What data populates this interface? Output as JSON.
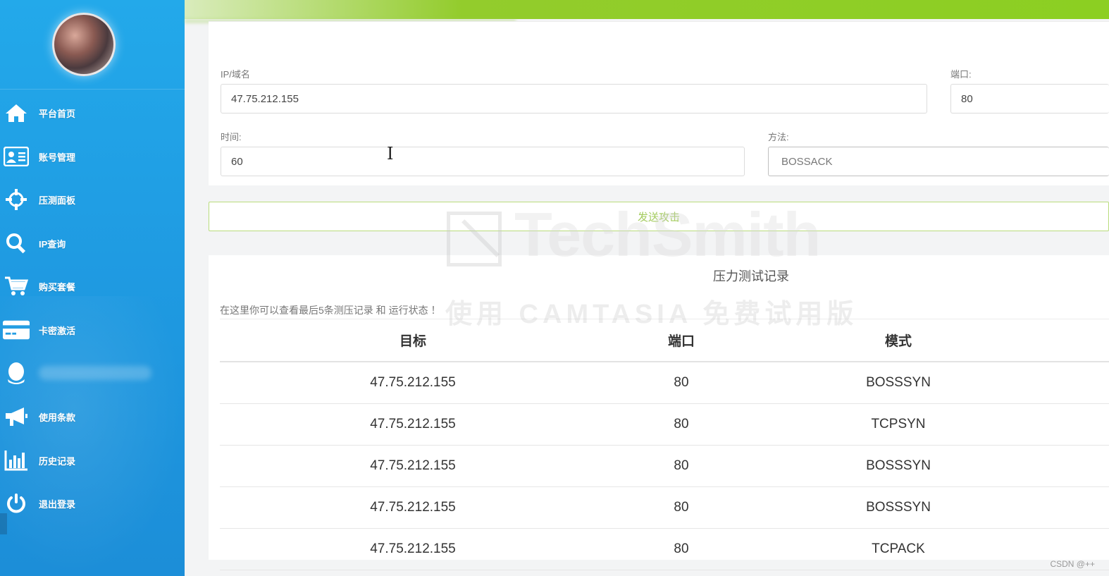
{
  "sidebar": {
    "items": [
      {
        "label": "平台首页",
        "icon": "home-icon"
      },
      {
        "label": "账号管理",
        "icon": "id-card-icon"
      },
      {
        "label": "压测面板",
        "icon": "crosshair-icon"
      },
      {
        "label": "IP查询",
        "icon": "search-icon"
      },
      {
        "label": "购买套餐",
        "icon": "cart-icon"
      },
      {
        "label": "卡密激活",
        "icon": "credit-card-icon"
      },
      {
        "label": "",
        "icon": "qq-icon"
      },
      {
        "label": "使用条款",
        "icon": "megaphone-icon"
      },
      {
        "label": "历史记录",
        "icon": "bar-chart-icon"
      },
      {
        "label": "退出登录",
        "icon": "power-icon"
      }
    ]
  },
  "form": {
    "ip_label": "IP/域名",
    "ip_value": "47.75.212.155",
    "port_label": "端口:",
    "port_value": "80",
    "time_label": "时间:",
    "time_value": "60",
    "method_label": "方法:",
    "method_value": "BOSSACK",
    "submit_label": "发送攻击"
  },
  "records": {
    "title": "压力测试记录",
    "subtitle": "在这里你可以查看最后5条测压记录 和 运行状态 ！",
    "columns": [
      "目标",
      "端口",
      "模式"
    ],
    "rows": [
      [
        "47.75.212.155",
        "80",
        "BOSSSYN"
      ],
      [
        "47.75.212.155",
        "80",
        "TCPSYN"
      ],
      [
        "47.75.212.155",
        "80",
        "BOSSSYN"
      ],
      [
        "47.75.212.155",
        "80",
        "BOSSSYN"
      ],
      [
        "47.75.212.155",
        "80",
        "TCPACK"
      ]
    ]
  },
  "watermark": {
    "brand": "TechSmith",
    "subtitle": "使用 CAMTASIA 免费试用版"
  },
  "footer": {
    "csdn": "CSDN @++"
  },
  "colors": {
    "sidebar": "#1f9be2",
    "topbar": "#8ccf22",
    "button_border": "#b9dc7c"
  }
}
